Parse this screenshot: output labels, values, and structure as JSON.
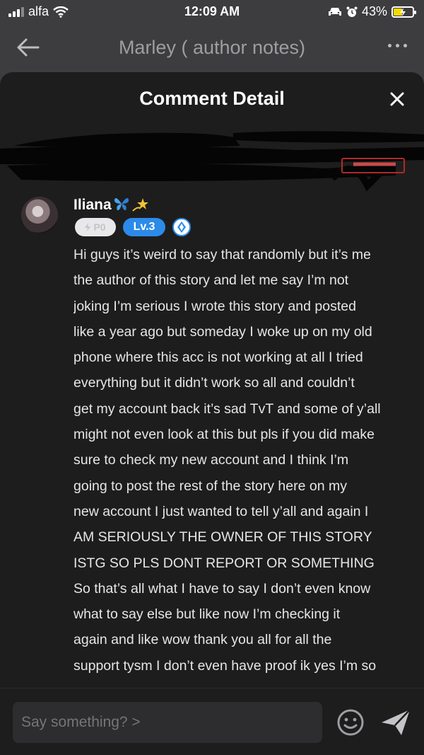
{
  "status_bar": {
    "carrier": "alfa",
    "time": "12:09 AM",
    "battery": "43%",
    "battery_level": 0.43
  },
  "nav": {
    "title": "Marley ( author notes)"
  },
  "sheet": {
    "title": "Comment Detail"
  },
  "comment": {
    "author": "Iliana",
    "badges": {
      "points": "P0",
      "level": "Lv.3"
    },
    "lines": [
      "Hi guys it’s weird to say that randomly but it’s me",
      "the author of this story and let me say I’m not",
      "joking I’m serious I wrote this story and posted",
      "like a year ago but someday I woke up on my old",
      "phone where this acc is not working at all I tried",
      "everything but it didn’t work so all and couldn’t",
      "get my account back it’s sad TvT and some of y’all",
      "might not even look at this but pls if you did make",
      "sure to check my new account and I think I’m",
      "going to post the rest of the story here on my",
      "new account I just wanted to tell y’all and again I",
      "AM SERIOUSLY THE OWNER OF THIS STORY",
      "ISTG SO PLS DONT REPORT OR SOMETHING",
      "So that’s all what I have to say I don’t even know",
      "what to say else but like now  I’m checking it",
      "again and like wow thank you all for all the",
      "support tysm I don’t even have proof ik yes I’m so"
    ]
  },
  "input": {
    "placeholder": "Say something? >"
  },
  "icons": {
    "back": "back-arrow-icon",
    "more": "more-icon",
    "close": "close-icon",
    "emoji": "emoji-icon",
    "send": "send-icon"
  }
}
